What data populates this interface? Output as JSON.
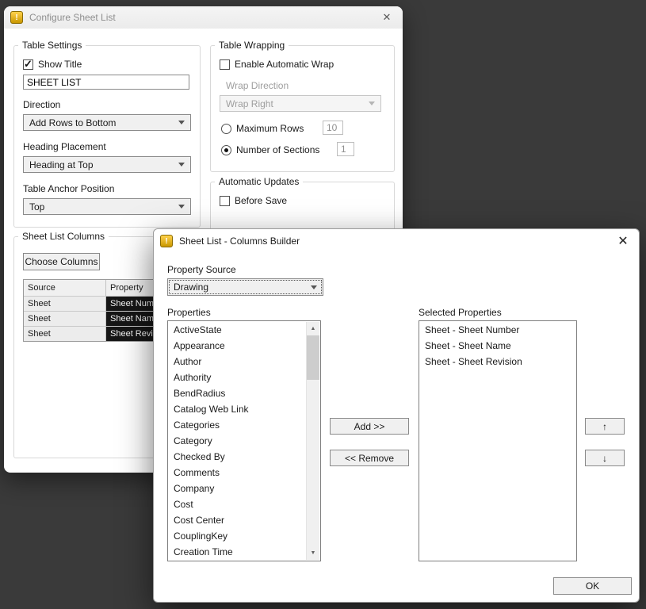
{
  "colors": {
    "desktop": "#3a3a3a",
    "icon_gold": "#e6af00",
    "selection_dark": "#161616"
  },
  "icons": {
    "app": "!",
    "close": "✕",
    "scroll_up": "▲",
    "scroll_down": "▼"
  },
  "config_dialog": {
    "title": "Configure Sheet List",
    "table_settings": {
      "legend": "Table Settings",
      "show_title_label": "Show Title",
      "title_value": "SHEET LIST",
      "direction_label": "Direction",
      "direction_value": "Add Rows to Bottom",
      "heading_placement_label": "Heading Placement",
      "heading_placement_value": "Heading at Top",
      "anchor_label": "Table Anchor Position",
      "anchor_value": "Top"
    },
    "table_wrapping": {
      "legend": "Table Wrapping",
      "enable_wrap_label": "Enable Automatic Wrap",
      "wrap_direction_label": "Wrap Direction",
      "wrap_direction_value": "Wrap Right",
      "max_rows_label": "Maximum Rows",
      "max_rows_value": "10",
      "sections_label": "Number of Sections",
      "sections_value": "1"
    },
    "automatic_updates": {
      "legend": "Automatic Updates",
      "before_save_label": "Before Save"
    },
    "sheet_list_columns": {
      "legend": "Sheet List Columns",
      "choose_columns_label": "Choose Columns",
      "table": {
        "headers": [
          "Source",
          "Property"
        ],
        "rows": [
          [
            "Sheet",
            "Sheet Number"
          ],
          [
            "Sheet",
            "Sheet Name"
          ],
          [
            "Sheet",
            "Sheet Revision"
          ]
        ]
      }
    }
  },
  "builder_dialog": {
    "title": "Sheet List - Columns Builder",
    "property_source_label": "Property Source",
    "property_source_value": "Drawing",
    "properties_label": "Properties",
    "properties": [
      "ActiveState",
      "Appearance",
      "Author",
      "Authority",
      "BendRadius",
      "Catalog Web Link",
      "Categories",
      "Category",
      "Checked By",
      "Comments",
      "Company",
      "Cost",
      "Cost Center",
      "CouplingKey",
      "Creation Time"
    ],
    "selected_properties_label": "Selected Properties",
    "selected_properties": [
      "Sheet - Sheet Number",
      "Sheet - Sheet Name",
      "Sheet - Sheet Revision"
    ],
    "add_button": "Add >>",
    "remove_button": "<< Remove",
    "move_up_button": "↑",
    "move_down_button": "↓",
    "ok_button": "OK"
  }
}
